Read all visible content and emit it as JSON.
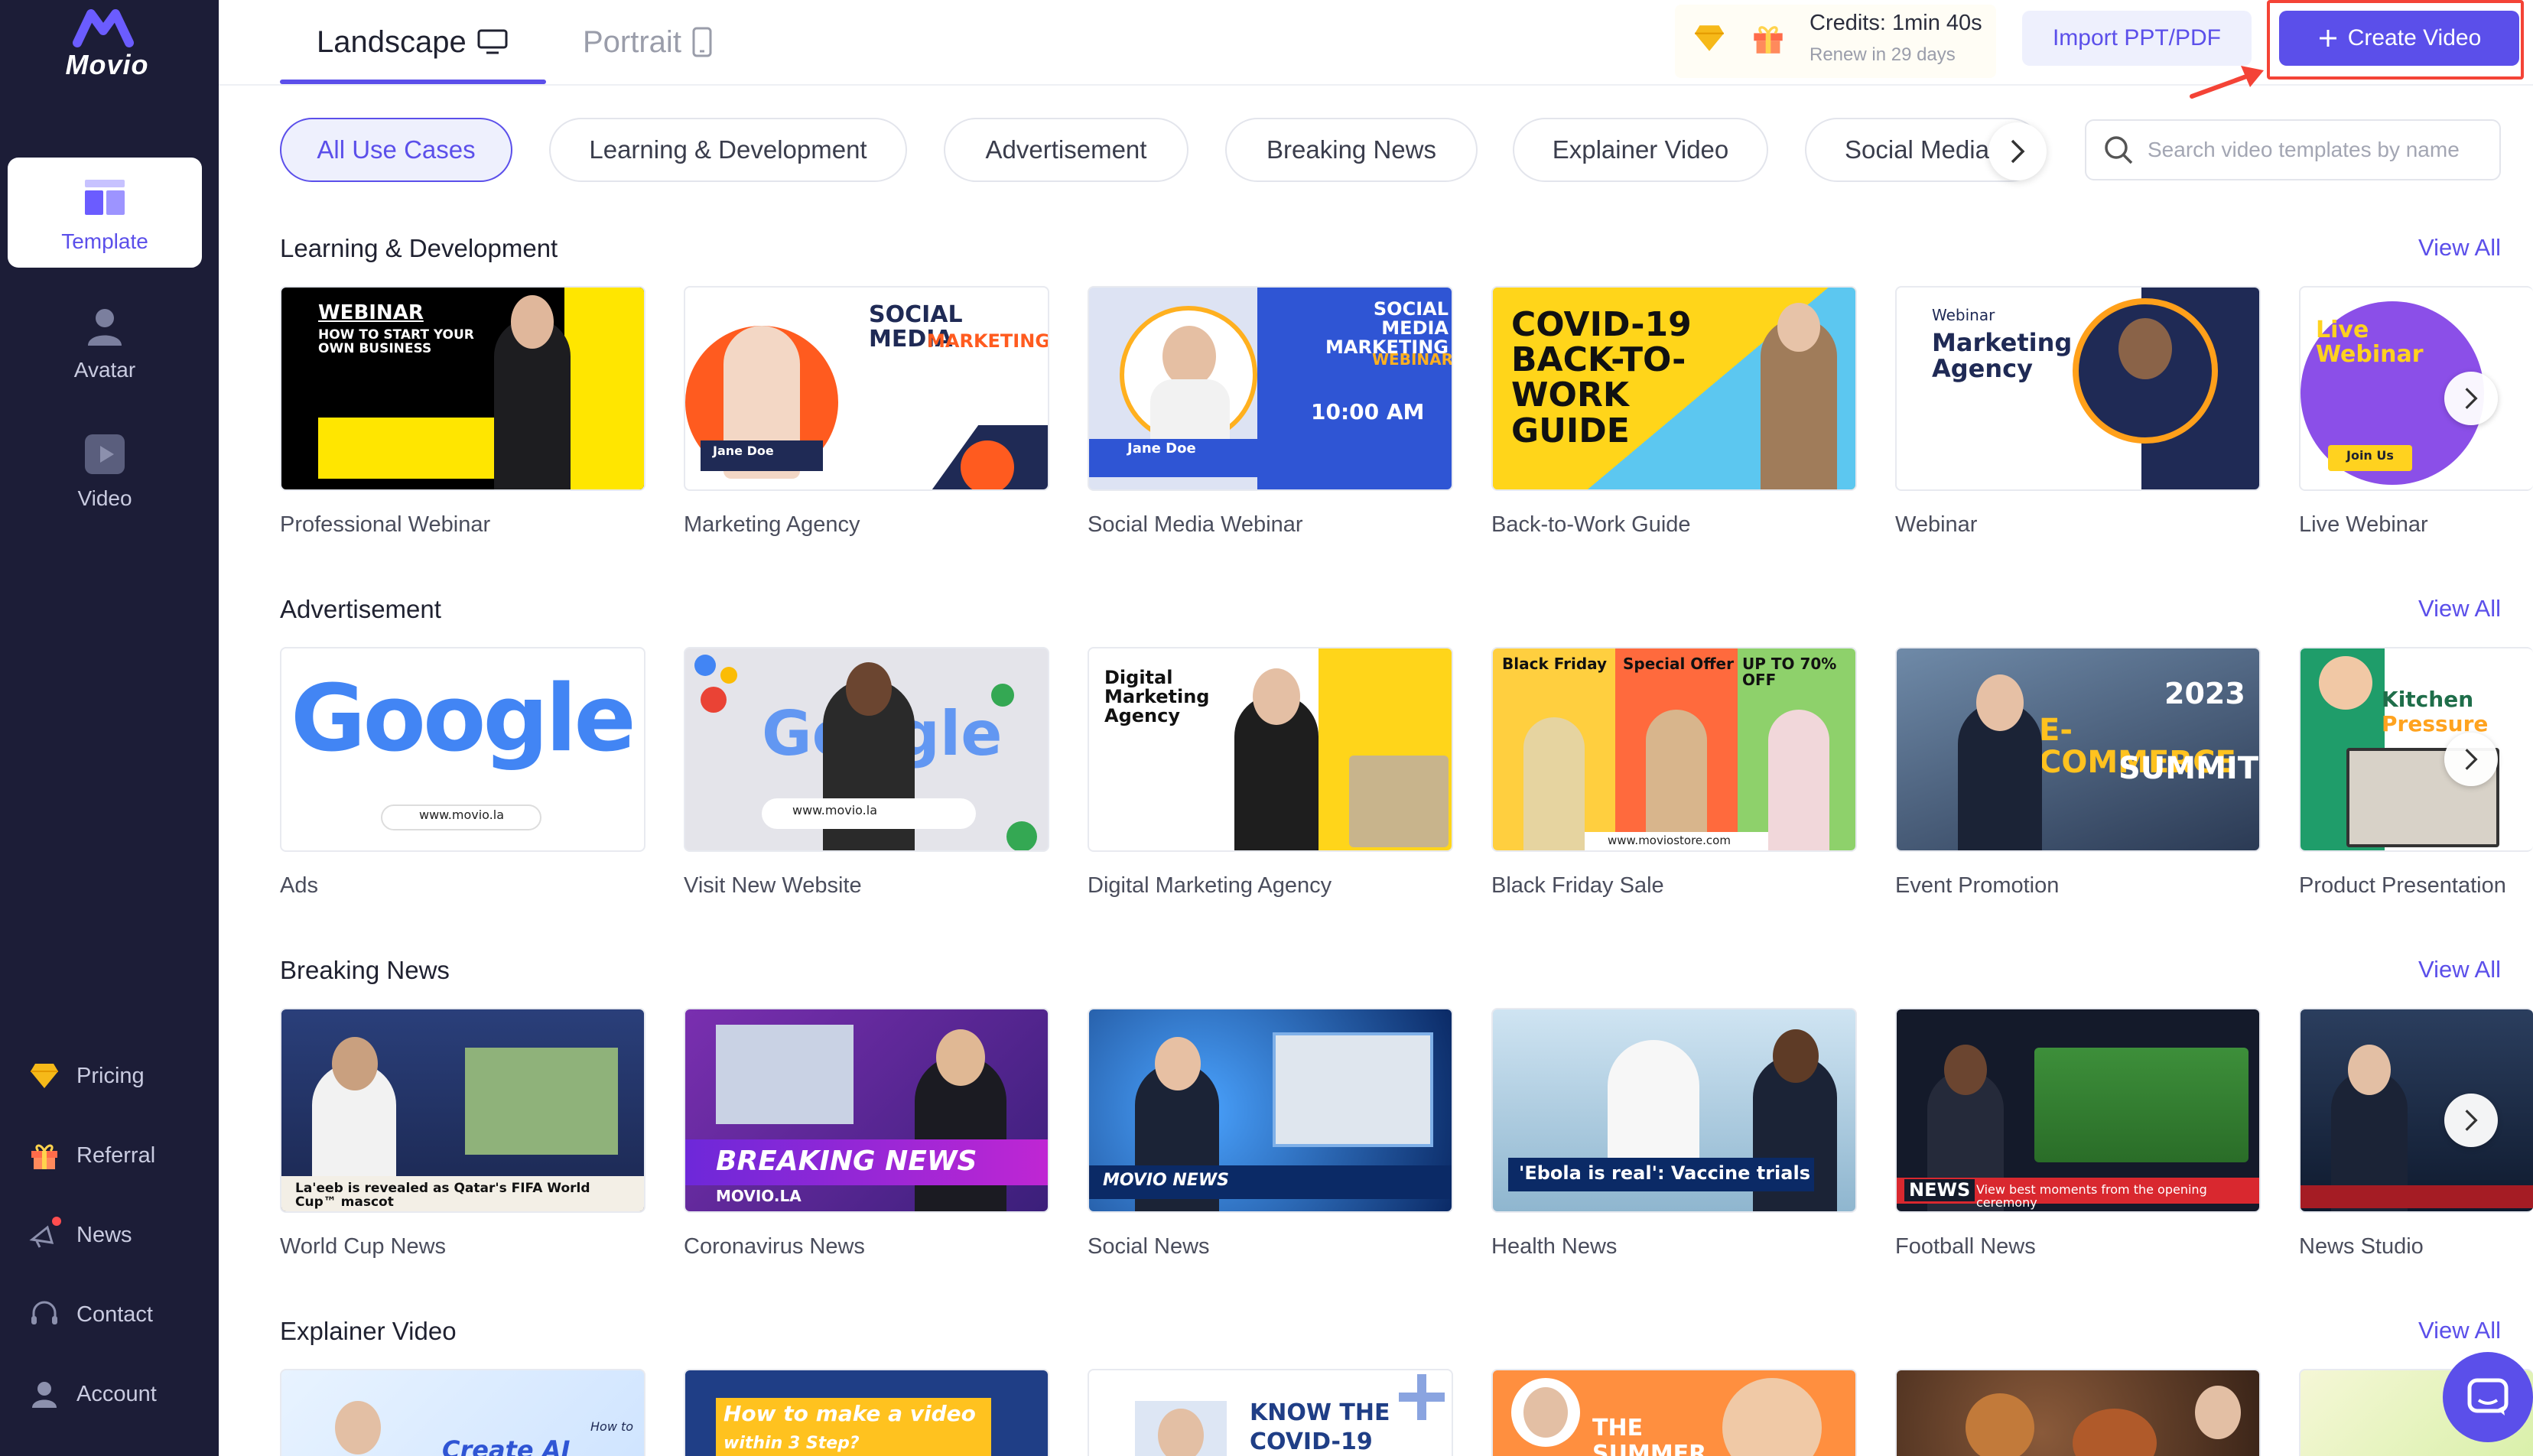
{
  "app": {
    "logo_text": "Movio"
  },
  "sidebar": {
    "items": [
      {
        "label": "Template",
        "icon": "template-icon"
      },
      {
        "label": "Avatar",
        "icon": "avatar-icon"
      },
      {
        "label": "Video",
        "icon": "video-icon"
      }
    ],
    "bottom": [
      {
        "label": "Pricing",
        "icon": "diamond-icon"
      },
      {
        "label": "Referral",
        "icon": "gift-icon"
      },
      {
        "label": "News",
        "icon": "news-icon"
      },
      {
        "label": "Contact",
        "icon": "headset-icon"
      },
      {
        "label": "Account",
        "icon": "user-icon"
      }
    ]
  },
  "header": {
    "tabs": [
      {
        "label": "Landscape",
        "icon": "monitor-icon"
      },
      {
        "label": "Portrait",
        "icon": "phone-icon"
      }
    ],
    "credits": "Credits: 1min 40s",
    "renew": "Renew in 29 days",
    "import_label": "Import PPT/PDF",
    "create_label": "Create Video"
  },
  "filters": {
    "chips": [
      "All Use Cases",
      "Learning & Development",
      "Advertisement",
      "Breaking News",
      "Explainer Video",
      "Social Media"
    ],
    "search_placeholder": "Search video templates by name"
  },
  "view_all": "View All",
  "sections": [
    {
      "title": "Learning & Development",
      "cards": [
        "Professional Webinar",
        "Marketing Agency",
        "Social Media Webinar",
        "Back-to-Work Guide",
        "Webinar",
        "Live Webinar"
      ]
    },
    {
      "title": "Advertisement",
      "cards": [
        "Ads",
        "Visit New Website",
        "Digital Marketing Agency",
        "Black Friday Sale",
        "Event Promotion",
        "Product Presentation"
      ]
    },
    {
      "title": "Breaking News",
      "cards": [
        "World Cup News",
        "Coronavirus News",
        "Social News",
        "Health News",
        "Football News",
        "News Studio"
      ]
    },
    {
      "title": "Explainer Video",
      "cards": [
        "",
        "",
        "",
        "",
        "",
        ""
      ]
    }
  ],
  "thumbs": {
    "t1": {
      "a": "WEBINAR",
      "b": "HOW TO START YOUR OWN BUSINESS"
    },
    "t2": {
      "a": "SOCIAL MEDIA",
      "b": "MARKETING",
      "c": "Jane Doe"
    },
    "t3": {
      "a": "SOCIAL MEDIA MARKETING",
      "b": "WEBINAR",
      "c": "10:00 AM",
      "d": "Jane Doe"
    },
    "t4": {
      "a": "COVID-19 BACK-TO-WORK GUIDE"
    },
    "t5": {
      "a": "Webinar",
      "b": "Marketing Agency"
    },
    "t6": {
      "a": "Live Webinar",
      "b": "Join Us"
    },
    "a1": {
      "a": "Google",
      "b": "www.movio.la"
    },
    "a2": {
      "a": "Google",
      "b": "www.movio.la"
    },
    "a3": {
      "a": "Digital Marketing Agency"
    },
    "a4": {
      "a": "Black Friday",
      "b": "Special Offer",
      "c": "UP TO 70% OFF",
      "d": "www.moviostore.com"
    },
    "a5": {
      "a": "2023",
      "b": "E-COMMERCE",
      "c": "SUMMIT"
    },
    "a6": {
      "a": "Kitchen",
      "b": "Pressure"
    },
    "n1": {
      "a": "La'eeb is revealed as Qatar's FIFA World Cup™ mascot"
    },
    "n2": {
      "a": "BREAKING NEWS",
      "b": "MOVIO.LA"
    },
    "n3": {
      "a": "MOVIO NEWS"
    },
    "n4": {
      "a": "'Ebola is real': Vaccine trials"
    },
    "n5": {
      "a": "NEWS",
      "b": "View best moments from the opening ceremony"
    },
    "e1": {
      "a": "How to",
      "b": "Create AI Video"
    },
    "e2": {
      "a": "How to make a video",
      "b": "within 3 Step?"
    },
    "e3": {
      "a": "KNOW THE",
      "b": "COVID-19"
    },
    "e4": {
      "a": "THE",
      "b": "SUMMER"
    }
  },
  "colors": {
    "accent": "#5b4fea",
    "sidebar": "#1c1d37",
    "highlight": "#f44336"
  }
}
